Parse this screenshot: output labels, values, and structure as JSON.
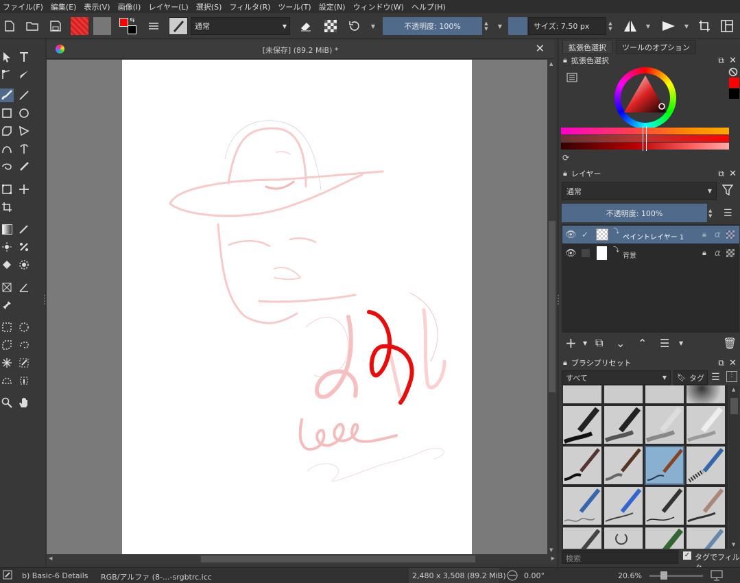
{
  "menu": [
    "ファイル(F)",
    "編集(E)",
    "表示(V)",
    "画像(I)",
    "レイヤー(L)",
    "選択(S)",
    "フィルタ(R)",
    "ツール(T)",
    "設定(N)",
    "ウィンドウ(W)",
    "ヘルプ(H)"
  ],
  "toolbar": {
    "blend_mode": "通常",
    "opacity": "不透明度: 100%",
    "size": "サイズ: 7.50 px",
    "foreground_color": "#ff0000",
    "background_color": "#000000"
  },
  "document": {
    "title": "[未保存]  (89.2 MiB) *"
  },
  "dock": {
    "tabs": [
      "拡張色選択",
      "ツールのオプション"
    ],
    "color_panel_title": "拡張色選択",
    "layers_panel_title": "レイヤー",
    "layers_blend": "通常",
    "layers_opacity": "不透明度: 100%",
    "layers": [
      {
        "name": "ペイントレイヤー 1",
        "selected": true,
        "visible": true
      },
      {
        "name": "背景",
        "selected": false,
        "visible": true
      }
    ],
    "brush_panel_title": "ブラシプリセット",
    "brush_filter": "すべて",
    "brush_tag": "タグ",
    "search_placeholder": "検索",
    "tag_filter_label": "タグでフィルタ"
  },
  "status": {
    "brush": "b) Basic-6 Details",
    "colorspace": "RGB/アルファ (8-...-srgbtrc.icc",
    "dimensions": "2,480 x 3,508 (89.2 MiB)",
    "rotation": "0.00°",
    "zoom": "20.6%"
  }
}
